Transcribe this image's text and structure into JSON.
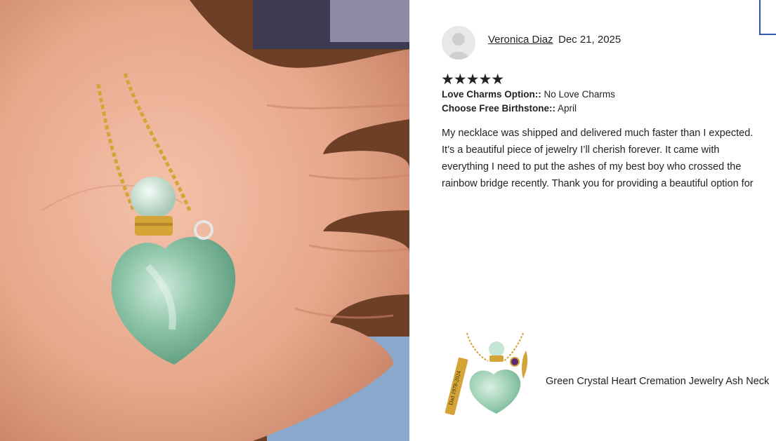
{
  "review": {
    "reviewer_name": "Veronica Diaz",
    "date": "Dec 21, 2025",
    "rating_stars": "★★★★★",
    "rating_value": 5,
    "options": [
      {
        "label": "Love Charms Option::",
        "value": "No Love Charms"
      },
      {
        "label": "Choose Free Birthstone::",
        "value": "April"
      }
    ],
    "text_lines": [
      "My necklace was shipped and delivered much faster than I expected.",
      "It’s a beautiful piece of jewelry I’ll cherish forever. It came with",
      "everything I need to put the ashes of my best boy who crossed the",
      "rainbow bridge recently. Thank you for providing a beautiful option for"
    ]
  },
  "product": {
    "title": "Green Crystal Heart Cremation Jewelry Ash Neck",
    "tag_engraving": "Dad 1978-2024"
  },
  "icons": {
    "avatar": "default-user-avatar-icon",
    "stars": "star-icon"
  },
  "colors": {
    "accent_frame": "#2f5bb7",
    "crystal": "#9fd0b4",
    "gold": "#d4a437"
  }
}
